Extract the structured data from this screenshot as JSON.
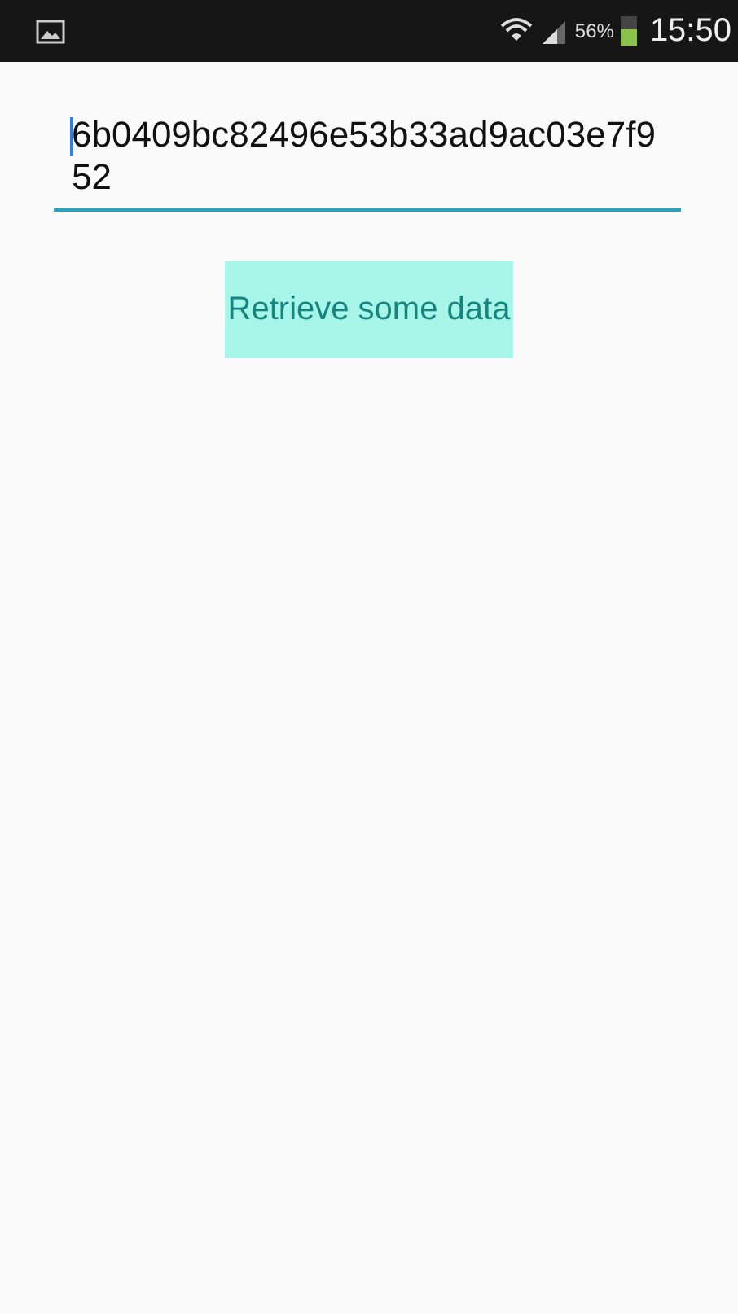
{
  "status_bar": {
    "battery_text": "56%",
    "time": "15:50"
  },
  "input": {
    "value": "6b0409bc82496e53b33ad9ac03e7f952"
  },
  "button": {
    "label": "Retrieve some data"
  }
}
